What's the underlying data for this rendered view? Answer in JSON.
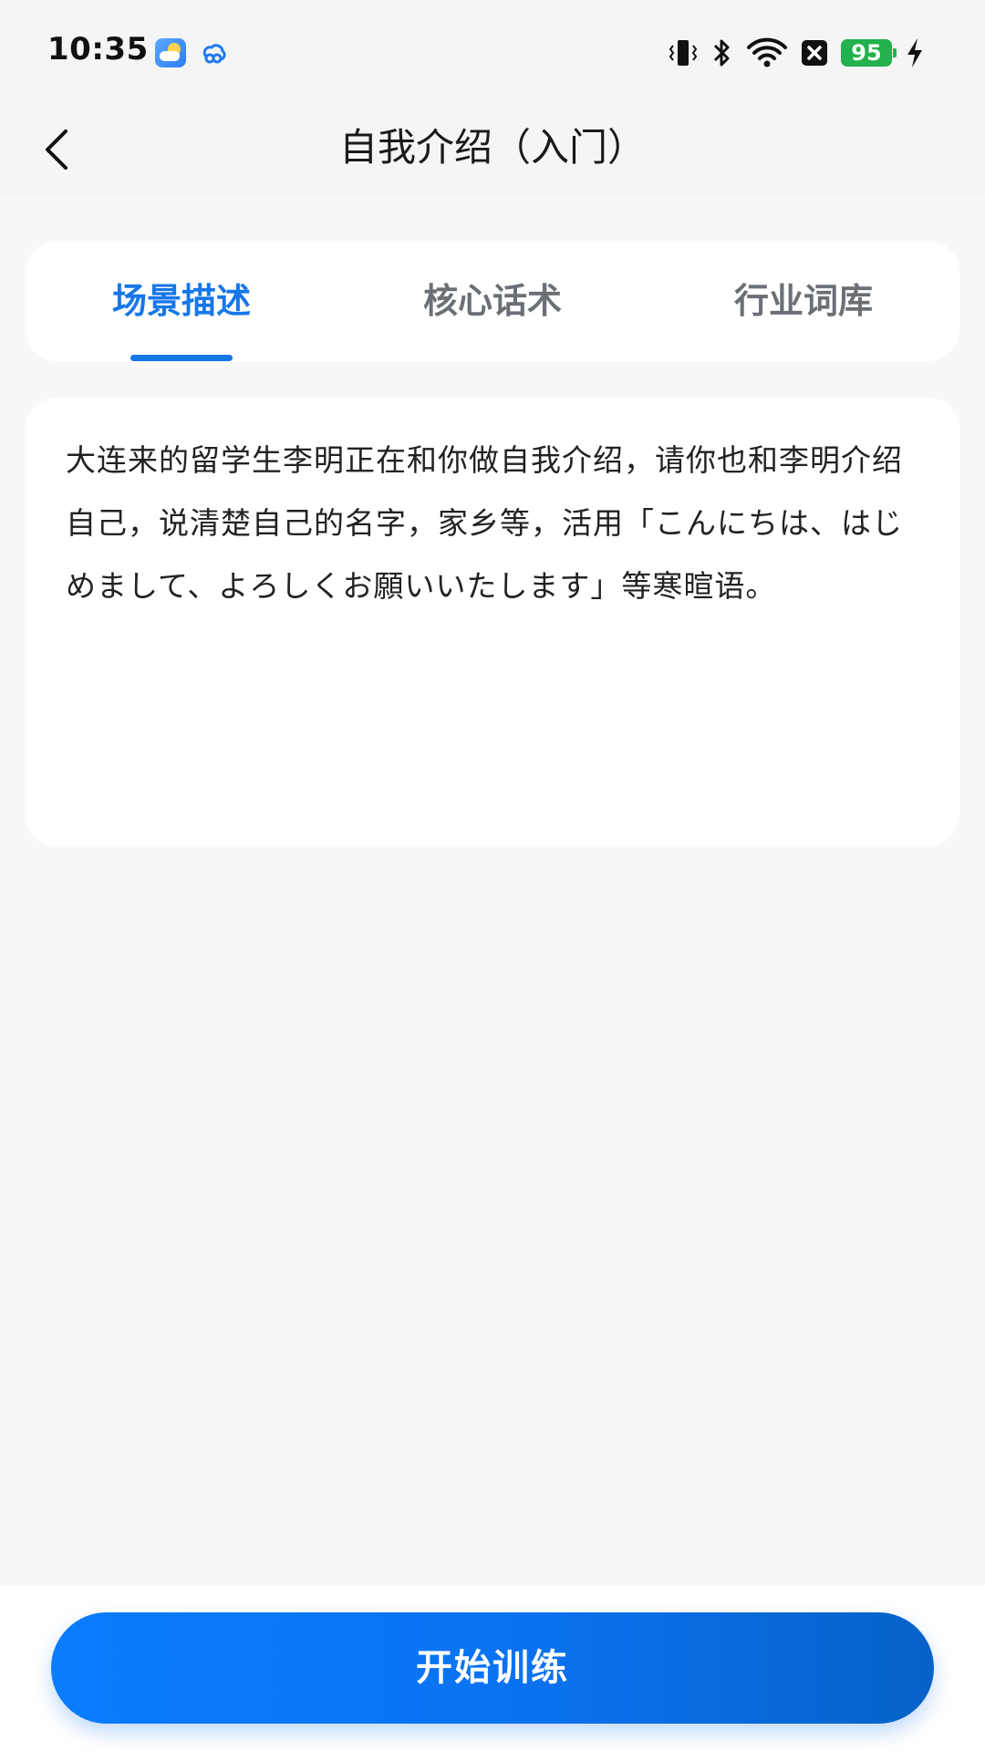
{
  "status_bar": {
    "time": "10:35",
    "battery": "95",
    "icons": [
      "weather-icon",
      "cloud-link-icon",
      "vibrate-icon",
      "bluetooth-icon",
      "wifi-icon",
      "no-sim-icon",
      "battery-icon",
      "charging-icon"
    ]
  },
  "header": {
    "title": "自我介绍（入门）",
    "back_icon": "chevron-left-icon"
  },
  "tabs": [
    {
      "label": "场景描述",
      "active": true
    },
    {
      "label": "核心话术",
      "active": false
    },
    {
      "label": "行业词库",
      "active": false
    }
  ],
  "scene": {
    "description": "大连来的留学生李明正在和你做自我介绍，请你也和李明介绍自己，说清楚自己的名字，家乡等，活用「こんにちは、はじめまして、よろしくお願いいたします」等寒暄语。"
  },
  "actions": {
    "start_label": "开始训练"
  },
  "colors": {
    "accent": "#1677e8",
    "tab_inactive": "#6b6f76",
    "background": "#f7f8fa",
    "battery": "#22b14c"
  }
}
